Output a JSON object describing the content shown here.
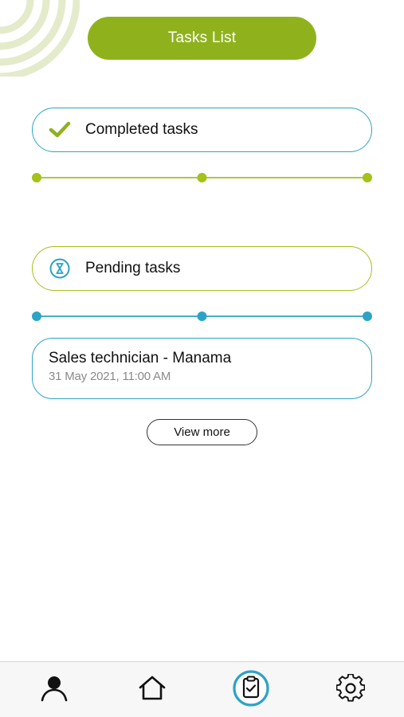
{
  "header": {
    "title": "Tasks List"
  },
  "sections": {
    "completed": {
      "label": "Completed tasks",
      "icon": "checkmark-icon",
      "color": "#8fb21c"
    },
    "pending": {
      "label": "Pending tasks",
      "icon": "hourglass-icon",
      "color": "#2da3c6"
    }
  },
  "tasks": [
    {
      "title": "Sales technician - Manama",
      "date": "31 May 2021, 11:00 AM"
    }
  ],
  "actions": {
    "view_more_label": "View more"
  },
  "bottom_nav": {
    "items": [
      {
        "icon": "person-icon",
        "active": false
      },
      {
        "icon": "home-icon",
        "active": false
      },
      {
        "icon": "clipboard-check-icon",
        "active": true
      },
      {
        "icon": "gear-icon",
        "active": false
      }
    ]
  },
  "colors": {
    "brand_green": "#8fb21c",
    "accent_blue": "#2da3c6",
    "deco_green": "#e3ebcb"
  }
}
